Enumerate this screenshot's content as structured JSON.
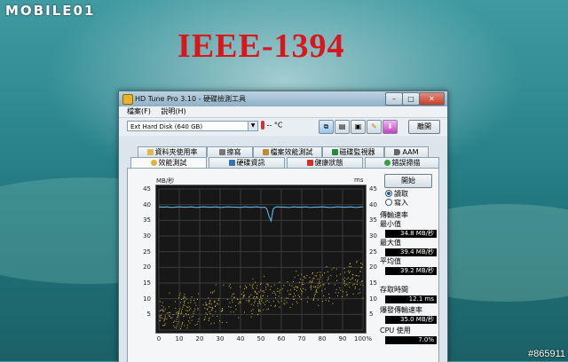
{
  "watermark": "MOBILE01",
  "headline": "IEEE-1394",
  "corner_tag": "#865911",
  "window": {
    "title": "HD Tune Pro 3.10 - 硬碟檢測工具",
    "menu": [
      "檔案(F)",
      "說明(H)"
    ],
    "drive_select": "Ext Hard Disk (640 GB)",
    "temperature": "-- °C",
    "exit_label": "離開",
    "tabs_row1": [
      {
        "label": "資料夾使用率",
        "icon": "folder-icon"
      },
      {
        "label": "擦寫",
        "icon": "erase-icon"
      },
      {
        "label": "檔案效能測試",
        "icon": "file-bench-icon"
      },
      {
        "label": "磁碟監視器",
        "icon": "monitor-icon"
      },
      {
        "label": "AAM",
        "icon": "speaker-icon"
      }
    ],
    "tabs_row2": [
      {
        "label": "效能測試",
        "icon": "benchmark-icon",
        "active": true
      },
      {
        "label": "硬碟資訊",
        "icon": "info-icon"
      },
      {
        "label": "健康狀態",
        "icon": "health-icon"
      },
      {
        "label": "錯誤掃描",
        "icon": "scan-icon"
      }
    ],
    "start_label": "開始",
    "mode_read": "讀取",
    "mode_write": "寫入",
    "rate_heading": "傳輸速率",
    "min_label": "最小值",
    "min_value": "34.8 MB/秒",
    "max_label": "最大值",
    "max_value": "39.4 MB/秒",
    "avg_label": "平均值",
    "avg_value": "39.2 MB/秒",
    "access_label": "存取時間",
    "access_value": "12.1 ms",
    "burst_label": "爆發傳輸速率",
    "burst_value": "35.0 MB/秒",
    "cpu_label": "CPU 使用",
    "cpu_value": "7.0%"
  },
  "chart_data": {
    "type": "line",
    "ylabel": "MB/秒",
    "ylabel_right": "ms",
    "y_ticks": [
      "45",
      "40",
      "35",
      "30",
      "25",
      "20",
      "15",
      "10",
      "5"
    ],
    "y_ticks_right": [
      "45",
      "40",
      "35",
      "30",
      "25",
      "20",
      "15",
      "10",
      "5"
    ],
    "x_ticks": [
      "0",
      "10",
      "20",
      "30",
      "40",
      "50",
      "60",
      "70",
      "80",
      "90",
      "100%"
    ],
    "ylim": [
      0,
      45
    ],
    "xlim": [
      0,
      100
    ],
    "series": [
      {
        "color": "#5fa8d6",
        "x": [
          0,
          2,
          4,
          6,
          8,
          10,
          12,
          14,
          16,
          18,
          20,
          22,
          24,
          26,
          28,
          30,
          32,
          34,
          36,
          38,
          40,
          42,
          44,
          46,
          48,
          50,
          52,
          53,
          54,
          55,
          56,
          57,
          58,
          60,
          62,
          64,
          66,
          68,
          70,
          72,
          74,
          76,
          78,
          80,
          82,
          84,
          86,
          88,
          90,
          92,
          94,
          96,
          98,
          100
        ],
        "y": [
          39.3,
          39.2,
          39.3,
          39.1,
          39.2,
          39.3,
          39.2,
          39.2,
          39.3,
          39.1,
          39.2,
          39.3,
          39.2,
          39.2,
          39.3,
          39.1,
          39.2,
          39.3,
          39.2,
          39.2,
          39.1,
          39.3,
          39.2,
          39.2,
          39.3,
          39.1,
          39.2,
          38.5,
          36.2,
          34.8,
          38.6,
          39.2,
          39.3,
          39.2,
          39.2,
          39.1,
          39.3,
          39.2,
          39.2,
          39.3,
          39.1,
          39.2,
          39.2,
          39.3,
          39.2,
          39.1,
          39.2,
          39.3,
          39.2,
          39.2,
          39.3,
          39.1,
          39.2,
          39.3
        ]
      },
      {
        "type": "scatter",
        "color": "#d4c13a",
        "trend_x": [
          0,
          100
        ],
        "trend_y": [
          5,
          17
        ],
        "spread": 7
      }
    ]
  }
}
